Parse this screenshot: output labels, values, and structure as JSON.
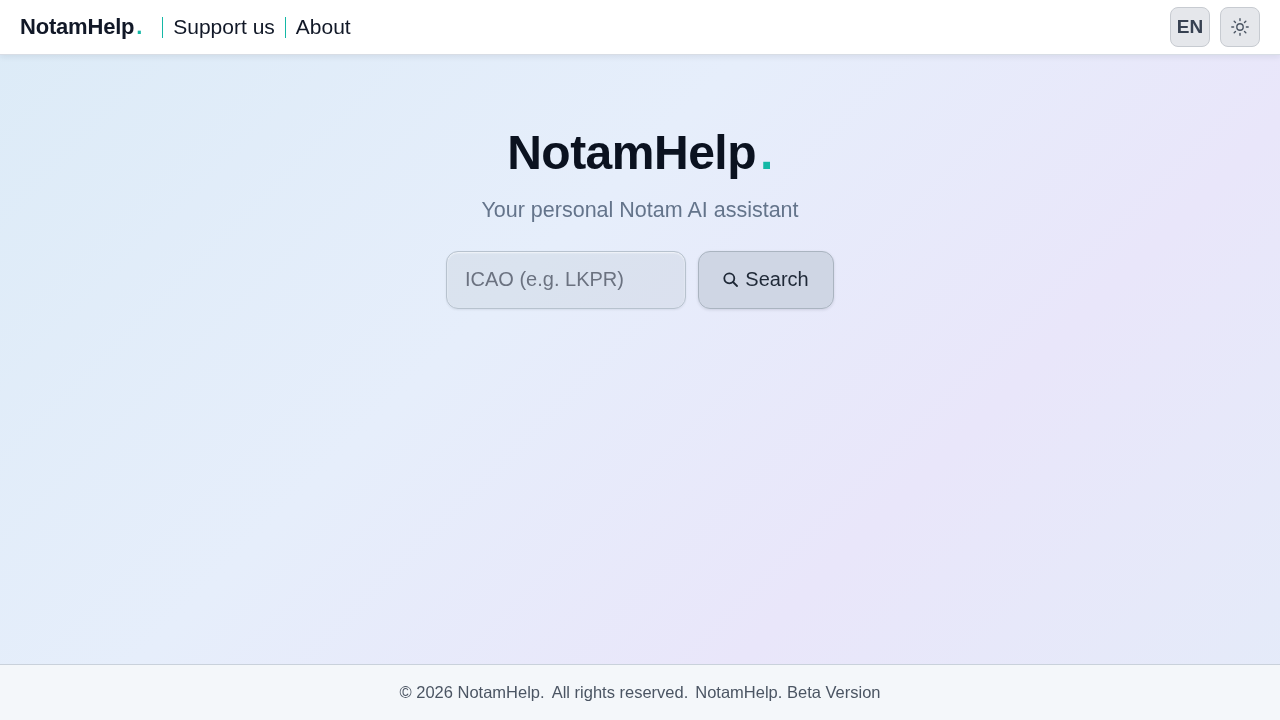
{
  "header": {
    "brand": {
      "name": "NotamHelp",
      "accent": "."
    },
    "nav": [
      "Support us",
      "About"
    ],
    "language_button": "EN"
  },
  "hero": {
    "title": {
      "name": "NotamHelp",
      "accent": "."
    },
    "subtitle": "Your personal Notam AI assistant",
    "search": {
      "placeholder": "ICAO (e.g. LKPR)",
      "button": "Search"
    }
  },
  "footer": {
    "parts": [
      "© 2026 NotamHelp.",
      "All rights reserved.",
      "NotamHelp. Beta Version"
    ]
  }
}
